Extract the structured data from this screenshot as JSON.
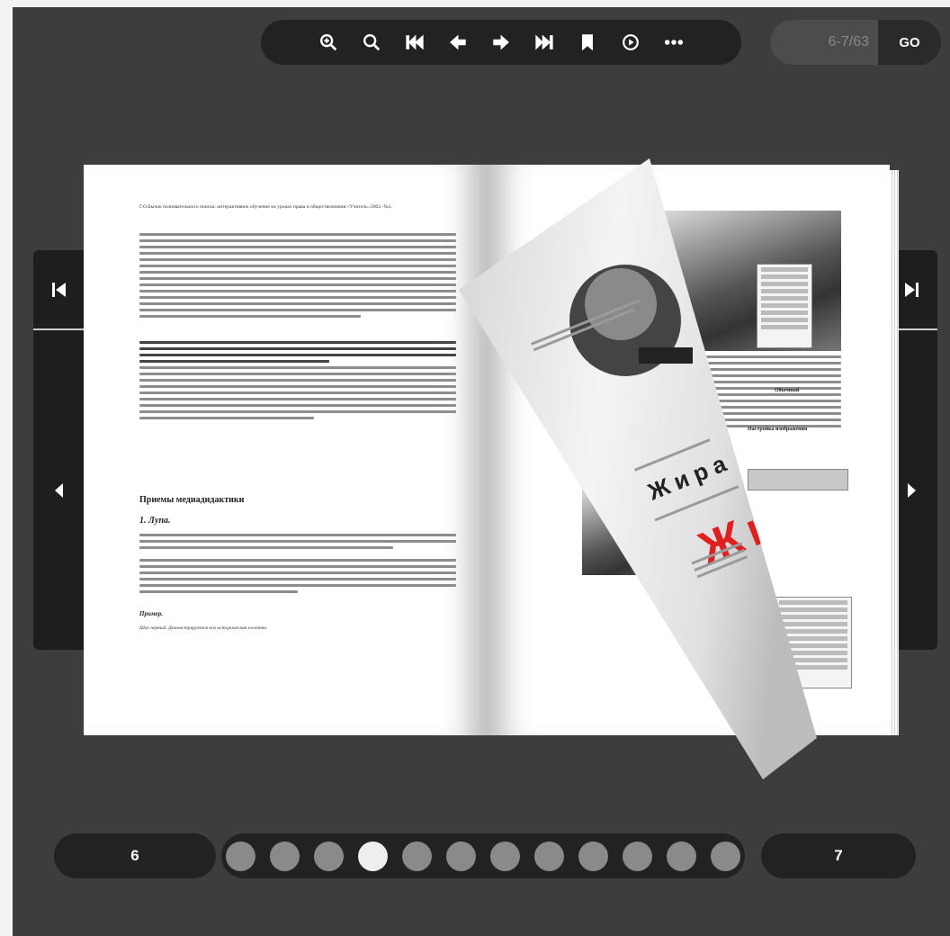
{
  "toolbar": {
    "buttons": [
      {
        "name": "zoom-in-button",
        "icon": "zoom-in-icon"
      },
      {
        "name": "zoom-out-button",
        "icon": "search-icon"
      },
      {
        "name": "first-page-button",
        "icon": "fast-rewind-icon"
      },
      {
        "name": "prev-page-button",
        "icon": "arrow-left-icon"
      },
      {
        "name": "next-page-button",
        "icon": "arrow-right-icon"
      },
      {
        "name": "last-page-button",
        "icon": "fast-forward-icon"
      },
      {
        "name": "bookmark-button",
        "icon": "bookmark-icon"
      },
      {
        "name": "autoplay-button",
        "icon": "play-circle-icon"
      },
      {
        "name": "more-button",
        "icon": "more-icon"
      }
    ]
  },
  "page_jump": {
    "value": "6-7/63",
    "go_label": "GO"
  },
  "footer": {
    "left_page": "6",
    "right_page": "7",
    "dot_count": 12,
    "active_dot": 4
  },
  "book": {
    "left": {
      "intro": "Г.О.Бычок познавательного поиска: интерактивное обучение на уроках права и обществознания //Учитель.-2002.-№3.",
      "heading": "Приемы медиадидактики",
      "subheading": "1. Лупа.",
      "example_label": "Пример.",
      "first_step": "Шаг первый. Демонстрируется вся историческая полотно."
    },
    "right": {
      "flip_word_small": "Жира",
      "flip_word_large": "Жи",
      "menu_label": "Настройка изображения",
      "bold_label": "Обычный"
    }
  },
  "colors": {
    "accent_red": "#e02020",
    "bg": "#3d3d3d",
    "bar": "#222222"
  }
}
